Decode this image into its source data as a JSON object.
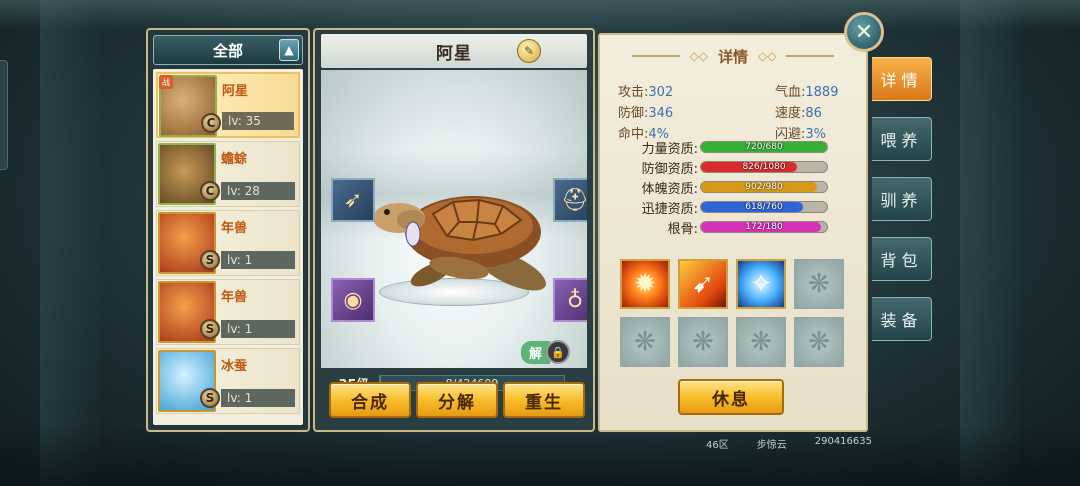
{
  "filter": {
    "label": "全部"
  },
  "pets": [
    {
      "name": "阿星",
      "level": "lv: 35",
      "grade": "C",
      "tag": "战",
      "selected": true
    },
    {
      "name": "蟾蜍",
      "level": "lv: 28",
      "grade": "C"
    },
    {
      "name": "年兽",
      "level": "lv: 1",
      "grade": "S"
    },
    {
      "name": "年兽",
      "level": "lv: 1",
      "grade": "S"
    },
    {
      "name": "冰蚕",
      "level": "lv: 1",
      "grade": "S"
    }
  ],
  "pet_detail": {
    "name": "阿星",
    "unlock_label": "解",
    "level_label": "35级",
    "exp_text": "8/424609",
    "exp_fraction": 1.88e-05,
    "buttons": {
      "synthesize": "合成",
      "decompose": "分解",
      "rebirth": "重生"
    }
  },
  "details": {
    "header": "详情",
    "stats": [
      {
        "label": "攻击:",
        "value": "302"
      },
      {
        "label": "气血:",
        "value": "1889"
      },
      {
        "label": "防御:",
        "value": "346"
      },
      {
        "label": "速度:",
        "value": "86"
      },
      {
        "label": "命中:",
        "value": "4%"
      },
      {
        "label": "闪避:",
        "value": "3%"
      }
    ],
    "aptitudes": [
      {
        "label": "力量资质:",
        "text": "720/680",
        "fraction": 1.0,
        "color": "#34b036"
      },
      {
        "label": "防御资质:",
        "text": "826/1080",
        "fraction": 0.765,
        "color": "#d72c2c"
      },
      {
        "label": "体魄资质:",
        "text": "902/980",
        "fraction": 0.92,
        "color": "#d69a18"
      },
      {
        "label": "迅捷资质:",
        "text": "618/760",
        "fraction": 0.813,
        "color": "#2f63d8"
      },
      {
        "label": "根骨:",
        "text": "172/180",
        "fraction": 0.955,
        "color": "#d632b8"
      }
    ],
    "rest_button": "休息"
  },
  "tabs": [
    {
      "label": "详情",
      "active": true
    },
    {
      "label": "喂养"
    },
    {
      "label": "驯养"
    },
    {
      "label": "背包"
    },
    {
      "label": "装备"
    }
  ],
  "footer": {
    "server": "46区",
    "player": "步惊云",
    "id": "290416635"
  },
  "colors": {
    "gold": "#f7be2c",
    "panel_bg": "#2a3d40",
    "active_tab": "#d9781a"
  }
}
